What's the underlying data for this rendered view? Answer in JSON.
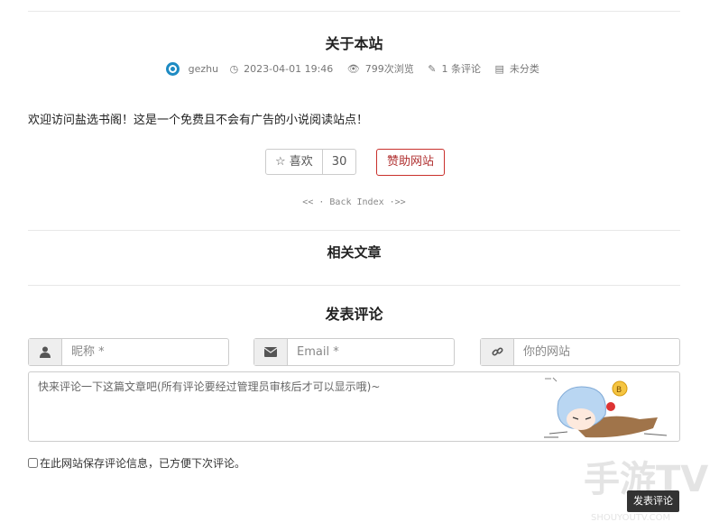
{
  "post": {
    "title": "关于本站",
    "author": "gezhu",
    "date": "2023-04-01 19:46",
    "views": "799次浏览",
    "comments": "1 条评论",
    "category": "未分类",
    "content": "欢迎访问盐选书阁！这是一个免费且不会有广告的小说阅读站点！"
  },
  "actions": {
    "like_label": "☆ 喜欢",
    "like_count": "30",
    "donate_label": "赞助网站",
    "back_index": "<< · Back Index ·>>"
  },
  "related": {
    "title": "相关文章"
  },
  "comment_form": {
    "title": "发表评论",
    "name_placeholder": "昵称 *",
    "email_placeholder": "Email *",
    "website_placeholder": "你的网站",
    "textarea_placeholder": "快来评论一下这篇文章吧(所有评论要经过管理员审核后才可以显示哦)~",
    "remember_label": "在此网站保存评论信息，已方便下次评论。",
    "submit_label": "发表评论"
  },
  "watermark": {
    "logo": "手游TV",
    "url": "SHOUYOUTV.COM"
  },
  "colors": {
    "accent_red": "#c9302c",
    "avatar_blue": "#1e8bc3",
    "submit_bg": "#333333"
  }
}
